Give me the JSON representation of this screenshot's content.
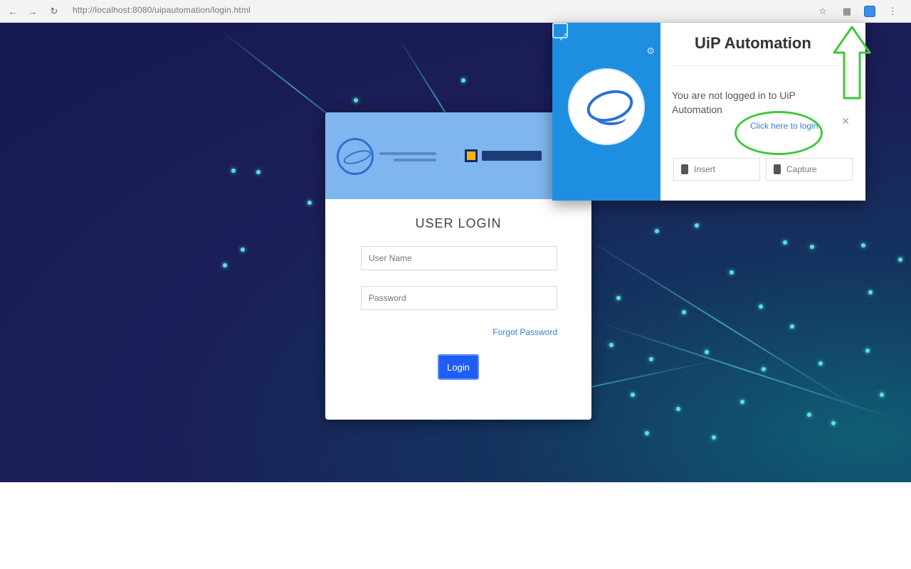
{
  "browser": {
    "url": "http://localhost:8080/uipautomation/login.html",
    "extension_icon_color": "#3a8ee6"
  },
  "login": {
    "title": "USER LOGIN",
    "username_placeholder": "User Name",
    "password_placeholder": "Password",
    "forgot_link": "Forgot Password",
    "login_button": "Login"
  },
  "popup": {
    "title": "UiP Automation",
    "message": "You are not logged in to UiP Automation",
    "link": "Click here to login",
    "buttons": [
      {
        "label": "Insert",
        "icon": "insert-icon"
      },
      {
        "label": "Capture",
        "icon": "capture-icon"
      }
    ]
  },
  "colors": {
    "page_background": "#1b1e58",
    "popup_side": "#1e8fe0",
    "login_header": "#7fb6ef",
    "login_button": "#1e5ef5",
    "annotation": "#3ec93a"
  }
}
